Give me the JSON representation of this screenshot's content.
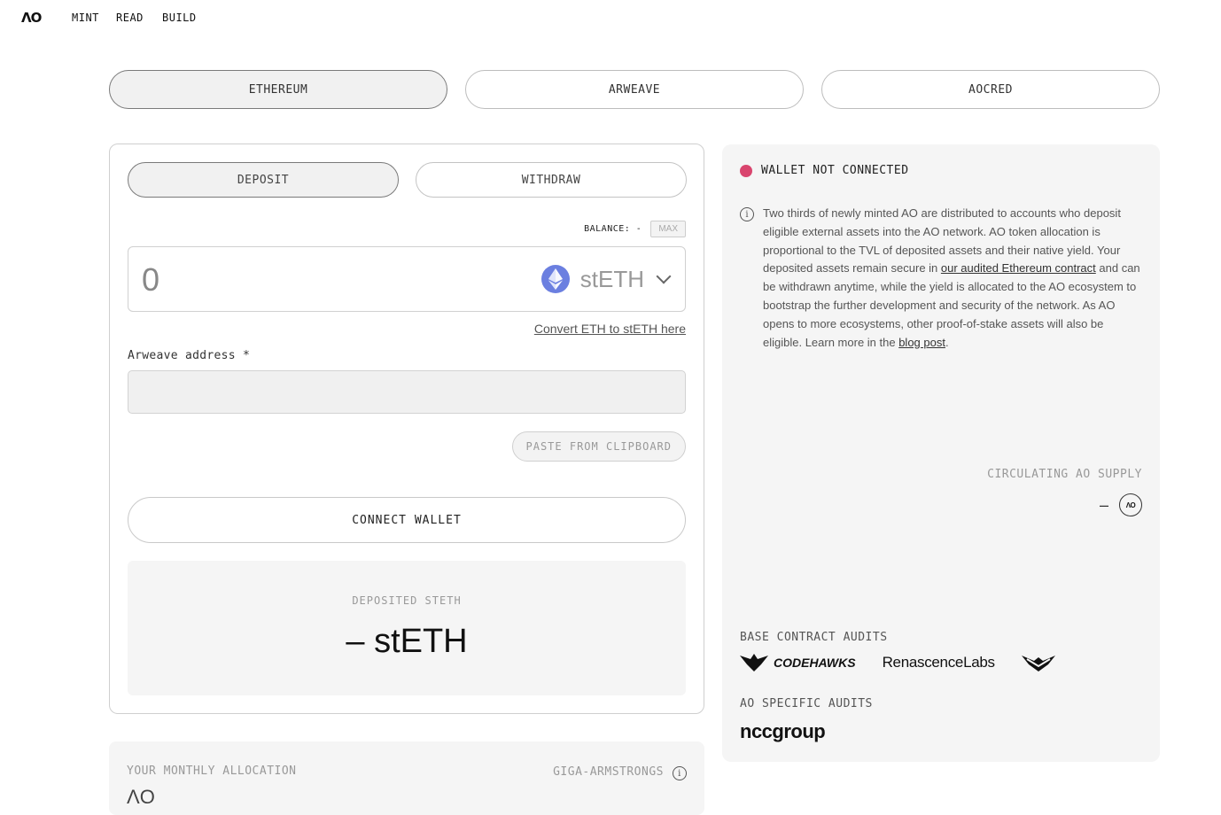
{
  "nav": {
    "logo": "ΛO",
    "links": [
      "MINT",
      "READ",
      "BUILD"
    ]
  },
  "chain_tabs": [
    {
      "label": "ETHEREUM",
      "active": true
    },
    {
      "label": "ARWEAVE",
      "active": false
    },
    {
      "label": "AOCRED",
      "active": false
    }
  ],
  "form": {
    "tabs": [
      {
        "label": "DEPOSIT",
        "active": true
      },
      {
        "label": "WITHDRAW",
        "active": false
      }
    ],
    "balance_label": "BALANCE: -",
    "max_label": "MAX",
    "amount": "0",
    "token": "stETH",
    "convert_link": "Convert ETH to stETH here",
    "address_label": "Arweave address *",
    "address_value": "",
    "paste_label": "PASTE FROM CLIPBOARD",
    "connect_label": "CONNECT WALLET",
    "deposited_label": "DEPOSITED STETH",
    "deposited_value": "– stETH"
  },
  "allocation": {
    "label": "YOUR MONTHLY ALLOCATION",
    "user": "GIGA-ARMSTRONGS",
    "peek": "ΛO"
  },
  "wallet": {
    "status": "WALLET NOT CONNECTED",
    "status_color": "#d9456e",
    "info_part1": "Two thirds of newly minted AO are distributed to accounts who deposit eligible external assets into the AO network. AO token allocation is proportional to the TVL of deposited assets and their native yield. Your deposited assets remain secure in ",
    "info_link1": "our audited Ethereum contract",
    "info_part2": " and can be withdrawn anytime, while the yield is allocated to the AO ecosystem to bootstrap the further development and security of the network. As AO opens to more ecosystems, other proof-of-stake assets will also be eligible. Learn more in the ",
    "info_link2": "blog post",
    "info_part3": "."
  },
  "supply": {
    "label": "CIRCULATING AO SUPPLY",
    "value": "–",
    "badge": "ΛO"
  },
  "audits": {
    "base_label": "BASE CONTRACT AUDITS",
    "codehawks": "CODEHAWKS",
    "renascence": "RenascenceLabs",
    "ao_label": "AO SPECIFIC AUDITS",
    "ncc": "nccgroup"
  }
}
